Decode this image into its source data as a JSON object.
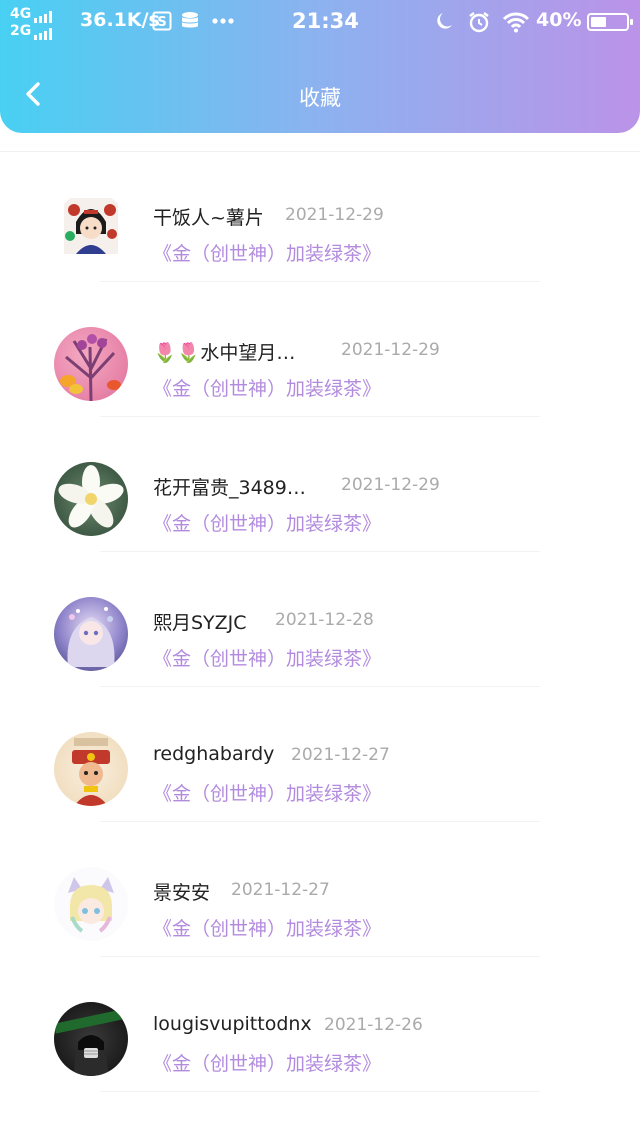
{
  "status_bar": {
    "net1": "4G",
    "net2": "2G",
    "speed": "36.1K/s",
    "time": "21:34",
    "battery": "40%",
    "icons": [
      "signal-icon",
      "s-badge-icon",
      "database-icon",
      "more-dots-icon",
      "moon-icon",
      "alarm-icon",
      "wifi-icon",
      "battery-icon"
    ]
  },
  "header": {
    "title": "收藏",
    "back_icon": "chevron-left-icon"
  },
  "items": [
    {
      "name": "干饭人~薯片",
      "date": "2021-12-29",
      "link": "《金（创世神）加装绿茶》"
    },
    {
      "name": "🌷🌷水中望月…",
      "date": "2021-12-29",
      "link": "《金（创世神）加装绿茶》"
    },
    {
      "name": "花开富贵_3489…",
      "date": "2021-12-29",
      "link": "《金（创世神）加装绿茶》"
    },
    {
      "name": "熙月SYZJC",
      "date": "2021-12-28",
      "link": "《金（创世神）加装绿茶》"
    },
    {
      "name": "redghabardy",
      "date": "2021-12-27",
      "link": "《金（创世神）加装绿茶》"
    },
    {
      "name": "景安安",
      "date": "2021-12-27",
      "link": "《金（创世神）加装绿茶》"
    },
    {
      "name": "lougisvupittodnx",
      "date": "2021-12-26",
      "link": "《金（创世神）加装绿茶》"
    }
  ],
  "colors": {
    "gradient_start": "#48d0f2",
    "gradient_end": "#bb93e8",
    "link": "#b38bde",
    "date": "#aaaaaa"
  }
}
